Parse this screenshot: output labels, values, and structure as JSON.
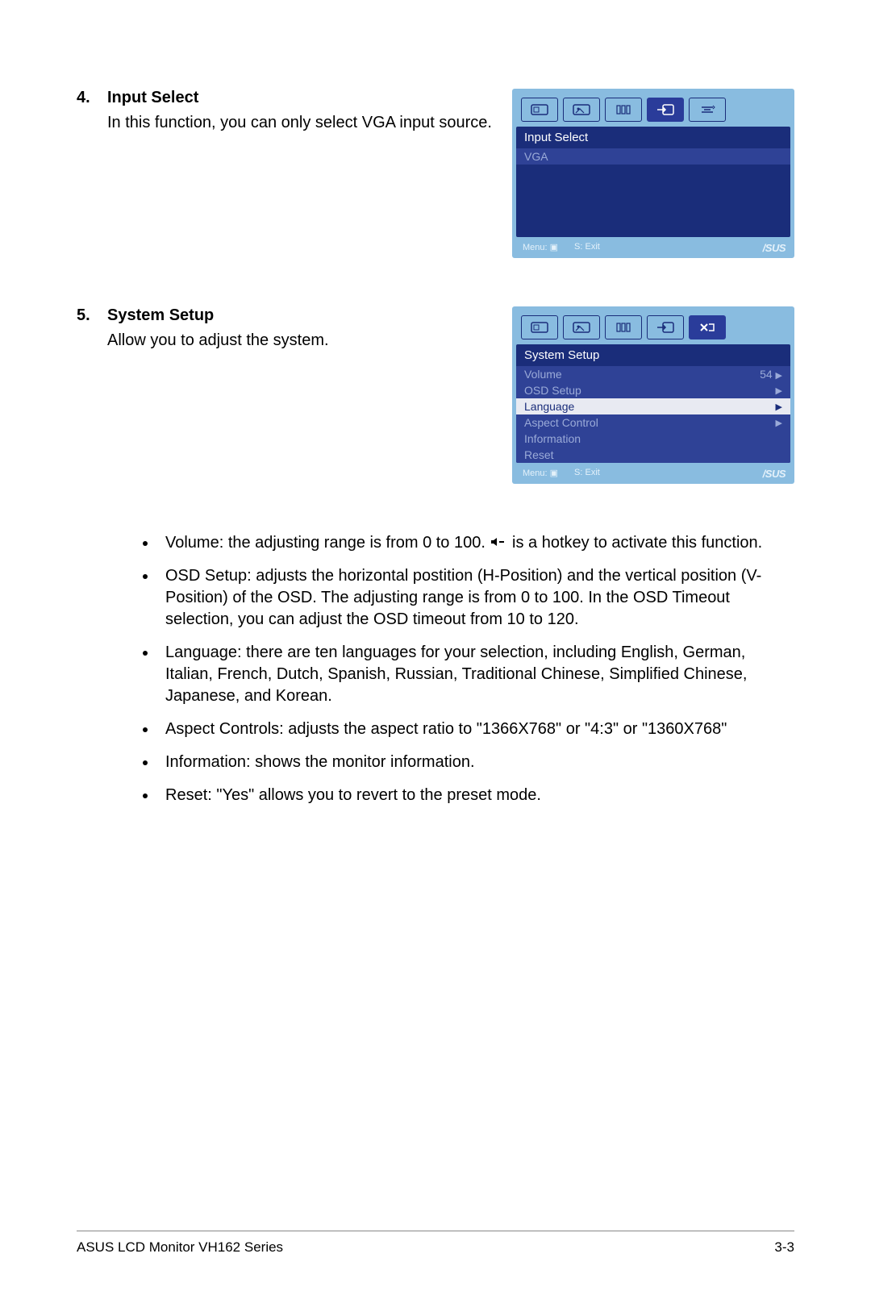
{
  "section4": {
    "num": "4.",
    "title": "Input Select",
    "desc": "In this function, you can only select VGA input source."
  },
  "section5": {
    "num": "5.",
    "title": "System Setup",
    "desc": "Allow you to adjust the system."
  },
  "osd1": {
    "title": "Input Select",
    "row0": "VGA",
    "footer_menu": "Menu: ▣",
    "footer_exit": "S: Exit",
    "asus": "/SUS"
  },
  "osd2": {
    "title": "System Setup",
    "row_volume": "Volume",
    "row_volume_val": "54",
    "row_osd": "OSD Setup",
    "row_lang": "Language",
    "row_aspect": "Aspect Control",
    "row_info": "Information",
    "row_reset": "Reset",
    "footer_menu": "Menu: ▣",
    "footer_exit": "S: Exit",
    "asus": "/SUS"
  },
  "bullets": {
    "b1a": "Volume: the adjusting range is from 0 to 100. ",
    "b1b": " is a hotkey to activate this function.",
    "b2": "OSD Setup: adjusts the horizontal postition (H-Position) and the vertical position (V-Position) of the OSD. The adjusting range is from 0 to 100. In the OSD Timeout selection, you can adjust the OSD timeout from 10 to 120.",
    "b3": "Language: there are ten languages for your selection, including English, German, Italian, French, Dutch, Spanish, Russian, Traditional Chinese, Simplified Chinese, Japanese, and Korean.",
    "b4": "Aspect Controls: adjusts the aspect ratio to \"1366X768\" or \"4:3\" or \"1360X768\"",
    "b5": "Information: shows the monitor information.",
    "b6": "Reset: \"Yes\" allows you to revert to the preset mode."
  },
  "footer": {
    "left": "ASUS LCD Monitor VH162 Series",
    "right": "3-3"
  }
}
